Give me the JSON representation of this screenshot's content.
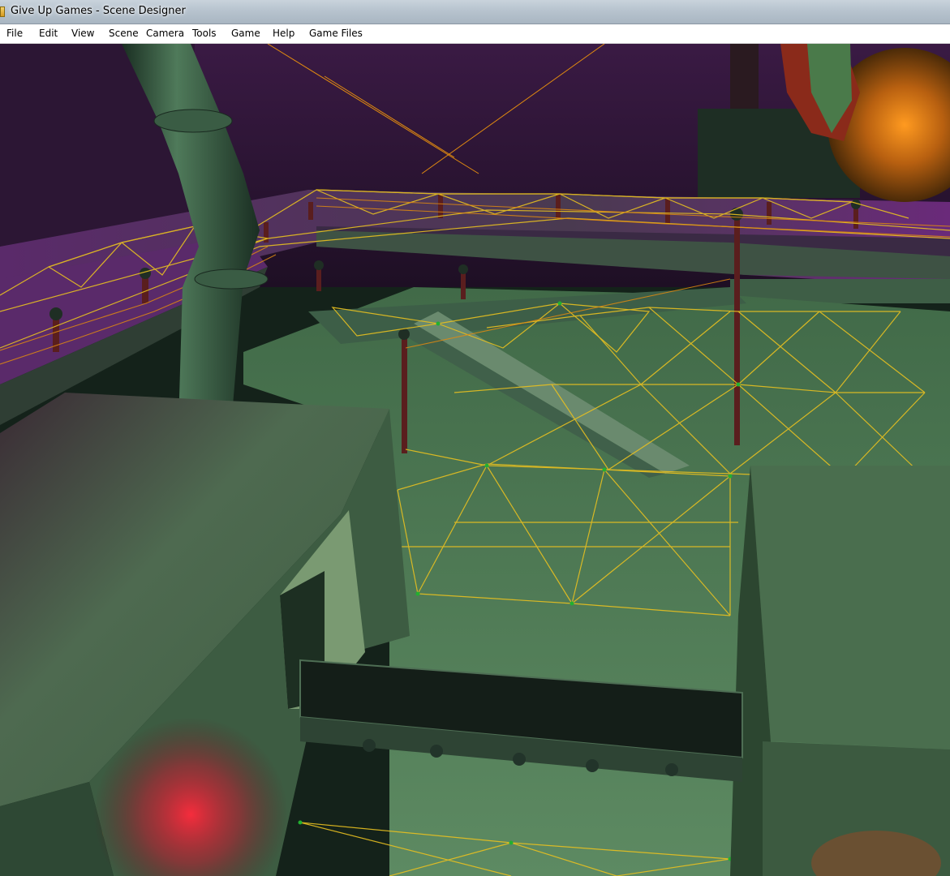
{
  "window": {
    "title": "Give Up Games - Scene Designer",
    "app_icon": "scene-designer-app-icon"
  },
  "menu": {
    "items": [
      {
        "id": "file",
        "label": "File"
      },
      {
        "id": "edit",
        "label": "Edit"
      },
      {
        "id": "view",
        "label": "View"
      },
      {
        "id": "scene",
        "label": "Scene"
      },
      {
        "id": "camera",
        "label": "Camera"
      },
      {
        "id": "tools",
        "label": "Tools"
      },
      {
        "id": "game",
        "label": "Game"
      },
      {
        "id": "help",
        "label": "Help"
      },
      {
        "id": "game-files",
        "label": "Game Files"
      }
    ]
  },
  "viewport": {
    "content": "3d-scene-render",
    "wireframe_color": "#e8c020",
    "wireframe_alt_color": "#e08a10",
    "floor_color": "#5d8a62",
    "wall_color": "#3a1f3f",
    "light_color": "#e8283a"
  }
}
